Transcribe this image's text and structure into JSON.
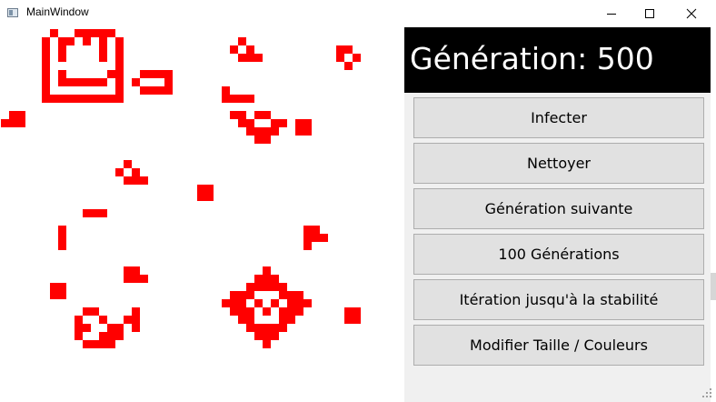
{
  "window": {
    "title": "MainWindow",
    "controls": {
      "minimize_icon": "minimize-icon",
      "maximize_icon": "maximize-icon",
      "close_icon": "close-icon"
    }
  },
  "grid": {
    "cell_color": "#ff0000",
    "background": "#ffffff",
    "live_cells": [
      [
        6,
        0
      ],
      [
        9,
        0
      ],
      [
        10,
        0
      ],
      [
        11,
        0
      ],
      [
        12,
        0
      ],
      [
        13,
        0
      ],
      [
        5,
        1
      ],
      [
        7,
        1
      ],
      [
        8,
        1
      ],
      [
        10,
        1
      ],
      [
        12,
        1
      ],
      [
        14,
        1
      ],
      [
        5,
        2
      ],
      [
        7,
        2
      ],
      [
        12,
        2
      ],
      [
        14,
        2
      ],
      [
        5,
        3
      ],
      [
        7,
        3
      ],
      [
        12,
        3
      ],
      [
        14,
        3
      ],
      [
        5,
        4
      ],
      [
        14,
        4
      ],
      [
        5,
        5
      ],
      [
        7,
        5
      ],
      [
        13,
        5
      ],
      [
        14,
        5
      ],
      [
        5,
        6
      ],
      [
        7,
        6
      ],
      [
        8,
        6
      ],
      [
        9,
        6
      ],
      [
        10,
        6
      ],
      [
        11,
        6
      ],
      [
        12,
        6
      ],
      [
        14,
        6
      ],
      [
        5,
        7
      ],
      [
        14,
        7
      ],
      [
        5,
        8
      ],
      [
        6,
        8
      ],
      [
        7,
        8
      ],
      [
        8,
        8
      ],
      [
        9,
        8
      ],
      [
        10,
        8
      ],
      [
        11,
        8
      ],
      [
        12,
        8
      ],
      [
        13,
        8
      ],
      [
        14,
        8
      ],
      [
        17,
        5
      ],
      [
        18,
        5
      ],
      [
        19,
        5
      ],
      [
        20,
        5
      ],
      [
        16,
        6
      ],
      [
        20,
        6
      ],
      [
        17,
        7
      ],
      [
        18,
        7
      ],
      [
        19,
        7
      ],
      [
        20,
        7
      ],
      [
        29,
        1
      ],
      [
        28,
        2
      ],
      [
        30,
        2
      ],
      [
        29,
        3
      ],
      [
        30,
        3
      ],
      [
        31,
        3
      ],
      [
        41,
        2
      ],
      [
        42,
        2
      ],
      [
        41,
        3
      ],
      [
        43,
        3
      ],
      [
        42,
        4
      ],
      [
        27,
        7
      ],
      [
        27,
        8
      ],
      [
        28,
        8
      ],
      [
        29,
        8
      ],
      [
        30,
        8
      ],
      [
        28,
        10
      ],
      [
        29,
        10
      ],
      [
        31,
        10
      ],
      [
        32,
        10
      ],
      [
        29,
        11
      ],
      [
        30,
        11
      ],
      [
        33,
        11
      ],
      [
        34,
        11
      ],
      [
        30,
        12
      ],
      [
        31,
        12
      ],
      [
        32,
        12
      ],
      [
        33,
        12
      ],
      [
        31,
        13
      ],
      [
        32,
        13
      ],
      [
        1,
        10
      ],
      [
        2,
        10
      ],
      [
        0,
        11
      ],
      [
        1,
        11
      ],
      [
        2,
        11
      ],
      [
        36,
        11
      ],
      [
        37,
        11
      ],
      [
        36,
        12
      ],
      [
        37,
        12
      ],
      [
        15,
        16
      ],
      [
        14,
        17
      ],
      [
        16,
        17
      ],
      [
        15,
        18
      ],
      [
        16,
        18
      ],
      [
        17,
        18
      ],
      [
        24,
        19
      ],
      [
        25,
        19
      ],
      [
        24,
        20
      ],
      [
        25,
        20
      ],
      [
        10,
        22
      ],
      [
        11,
        22
      ],
      [
        12,
        22
      ],
      [
        7,
        24
      ],
      [
        7,
        25
      ],
      [
        7,
        26
      ],
      [
        37,
        24
      ],
      [
        38,
        24
      ],
      [
        37,
        25
      ],
      [
        38,
        25
      ],
      [
        37,
        26
      ],
      [
        39,
        25
      ],
      [
        15,
        29
      ],
      [
        16,
        29
      ],
      [
        15,
        30
      ],
      [
        16,
        30
      ],
      [
        17,
        30
      ],
      [
        6,
        31
      ],
      [
        7,
        31
      ],
      [
        6,
        32
      ],
      [
        7,
        32
      ],
      [
        42,
        34
      ],
      [
        43,
        34
      ],
      [
        42,
        35
      ],
      [
        43,
        35
      ],
      [
        10,
        34
      ],
      [
        11,
        34
      ],
      [
        16,
        34
      ],
      [
        9,
        35
      ],
      [
        12,
        35
      ],
      [
        15,
        35
      ],
      [
        16,
        35
      ],
      [
        9,
        36
      ],
      [
        10,
        36
      ],
      [
        13,
        36
      ],
      [
        14,
        36
      ],
      [
        16,
        36
      ],
      [
        9,
        37
      ],
      [
        12,
        37
      ],
      [
        13,
        37
      ],
      [
        14,
        37
      ],
      [
        10,
        38
      ],
      [
        11,
        38
      ],
      [
        12,
        38
      ],
      [
        13,
        38
      ],
      [
        32,
        29
      ],
      [
        31,
        30
      ],
      [
        32,
        30
      ],
      [
        33,
        30
      ],
      [
        30,
        31
      ],
      [
        31,
        31
      ],
      [
        32,
        31
      ],
      [
        33,
        31
      ],
      [
        34,
        31
      ],
      [
        28,
        32
      ],
      [
        29,
        32
      ],
      [
        30,
        32
      ],
      [
        34,
        32
      ],
      [
        35,
        32
      ],
      [
        36,
        32
      ],
      [
        27,
        33
      ],
      [
        28,
        33
      ],
      [
        29,
        33
      ],
      [
        31,
        33
      ],
      [
        33,
        33
      ],
      [
        35,
        33
      ],
      [
        36,
        33
      ],
      [
        37,
        33
      ],
      [
        28,
        34
      ],
      [
        29,
        34
      ],
      [
        30,
        34
      ],
      [
        32,
        34
      ],
      [
        34,
        34
      ],
      [
        35,
        34
      ],
      [
        36,
        34
      ],
      [
        29,
        35
      ],
      [
        30,
        35
      ],
      [
        34,
        35
      ],
      [
        35,
        35
      ],
      [
        30,
        36
      ],
      [
        31,
        36
      ],
      [
        32,
        36
      ],
      [
        33,
        36
      ],
      [
        34,
        36
      ],
      [
        31,
        37
      ],
      [
        32,
        37
      ],
      [
        33,
        37
      ],
      [
        32,
        38
      ]
    ]
  },
  "panel": {
    "generation_label": "Génération: 500",
    "buttons": [
      {
        "label": "Infecter"
      },
      {
        "label": "Nettoyer"
      },
      {
        "label": "Génération suivante"
      },
      {
        "label": "100 Générations"
      },
      {
        "label": "Itération jusqu'à la stabilité"
      },
      {
        "label": "Modifier Taille / Couleurs"
      }
    ]
  }
}
